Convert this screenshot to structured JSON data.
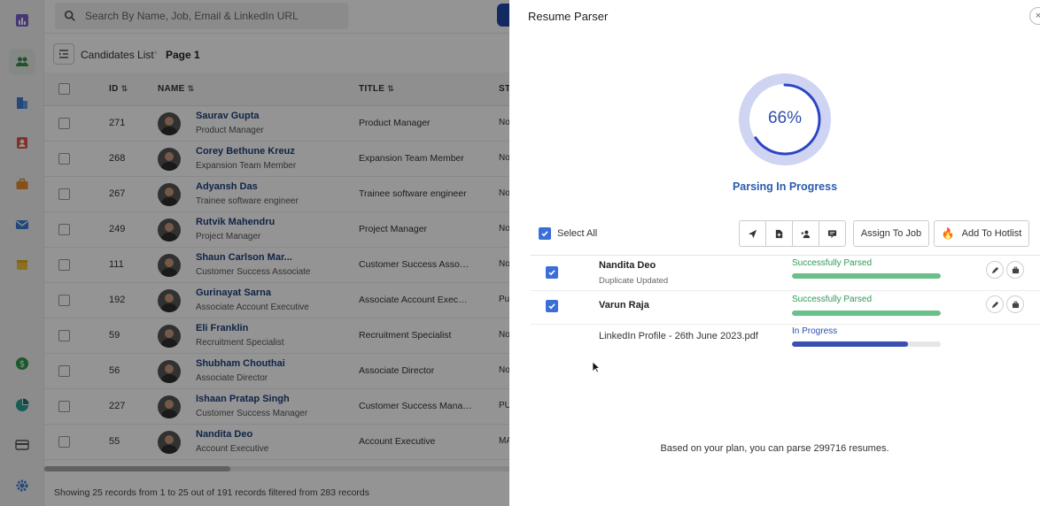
{
  "search": {
    "placeholder": "Search By Name, Job, Email & LinkedIn URL"
  },
  "breadcrumb": {
    "list": "Candidates List",
    "page": "Page 1"
  },
  "table": {
    "headers": {
      "id": "ID",
      "name": "NAME",
      "title": "TITLE",
      "status": "ST"
    },
    "rows": [
      {
        "id": "271",
        "name": "Saurav Gupta",
        "sub": "Product Manager",
        "title": "Product Manager",
        "status": "No"
      },
      {
        "id": "268",
        "name": "Corey Bethune Kreuz",
        "sub": "Expansion Team Member",
        "title": "Expansion Team Member",
        "status": "No"
      },
      {
        "id": "267",
        "name": "Adyansh Das",
        "sub": "Trainee software engineer",
        "title": "Trainee software engineer",
        "status": "No"
      },
      {
        "id": "249",
        "name": "Rutvik Mahendru",
        "sub": "Project Manager",
        "title": "Project Manager",
        "status": "No"
      },
      {
        "id": "111",
        "name": "Shaun Carlson Mar...",
        "sub": "Customer Success Associate",
        "title": "Customer Success Associ...",
        "status": "No"
      },
      {
        "id": "192",
        "name": "Gurinayat Sarna",
        "sub": "Associate Account Executive",
        "title": "Associate Account Execut...",
        "status": "Pu"
      },
      {
        "id": "59",
        "name": "Eli Franklin",
        "sub": "Recruitment Specialist",
        "title": "Recruitment Specialist",
        "status": "No"
      },
      {
        "id": "56",
        "name": "Shubham Chouthai",
        "sub": "Associate Director",
        "title": "Associate Director",
        "status": "No"
      },
      {
        "id": "227",
        "name": "Ishaan Pratap Singh",
        "sub": "Customer Success Manager",
        "title": "Customer Success Manag...",
        "status": "PU"
      },
      {
        "id": "55",
        "name": "Nandita Deo",
        "sub": "Account Executive",
        "title": "Account Executive",
        "status": "MA"
      }
    ],
    "footer": "Showing 25 records from 1 to 25 out of 191 records filtered from 283 records"
  },
  "parser": {
    "title": "Resume Parser",
    "close": "×",
    "progress_percent": 66,
    "progress_text": "66%",
    "status_label": "Parsing In Progress",
    "select_all": "Select All",
    "assign_label": "Assign To Job",
    "hotlist_label": "Add To Hotlist",
    "items": [
      {
        "name": "Nandita Deo",
        "sub": "Duplicate Updated",
        "status": "Successfully Parsed",
        "progress": 1.0
      },
      {
        "name": "Varun Raja",
        "status": "Successfully Parsed",
        "progress": 1.0
      },
      {
        "file": "LinkedIn Profile - 26th June 2023.pdf",
        "status": "In Progress",
        "progress": 0.78
      }
    ],
    "plan_note": "Based on your plan, you can parse 299716 resumes."
  },
  "colors": {
    "accent": "#2f4fb0",
    "success": "#2f9a55",
    "checkbox": "#3a6ed8",
    "ring_track": "#cfd4f2",
    "ring_fill": "#2b44c4"
  },
  "icons": {
    "rail": [
      "analytics-icon",
      "candidates-icon",
      "company-icon",
      "contacts-icon",
      "jobs-icon",
      "mail-icon",
      "calendar-icon",
      "billing-icon",
      "reports-icon",
      "card-icon",
      "settings-icon"
    ],
    "bulk_actions": [
      "send-icon",
      "add-file-icon",
      "add-user-icon",
      "comment-icon"
    ]
  }
}
